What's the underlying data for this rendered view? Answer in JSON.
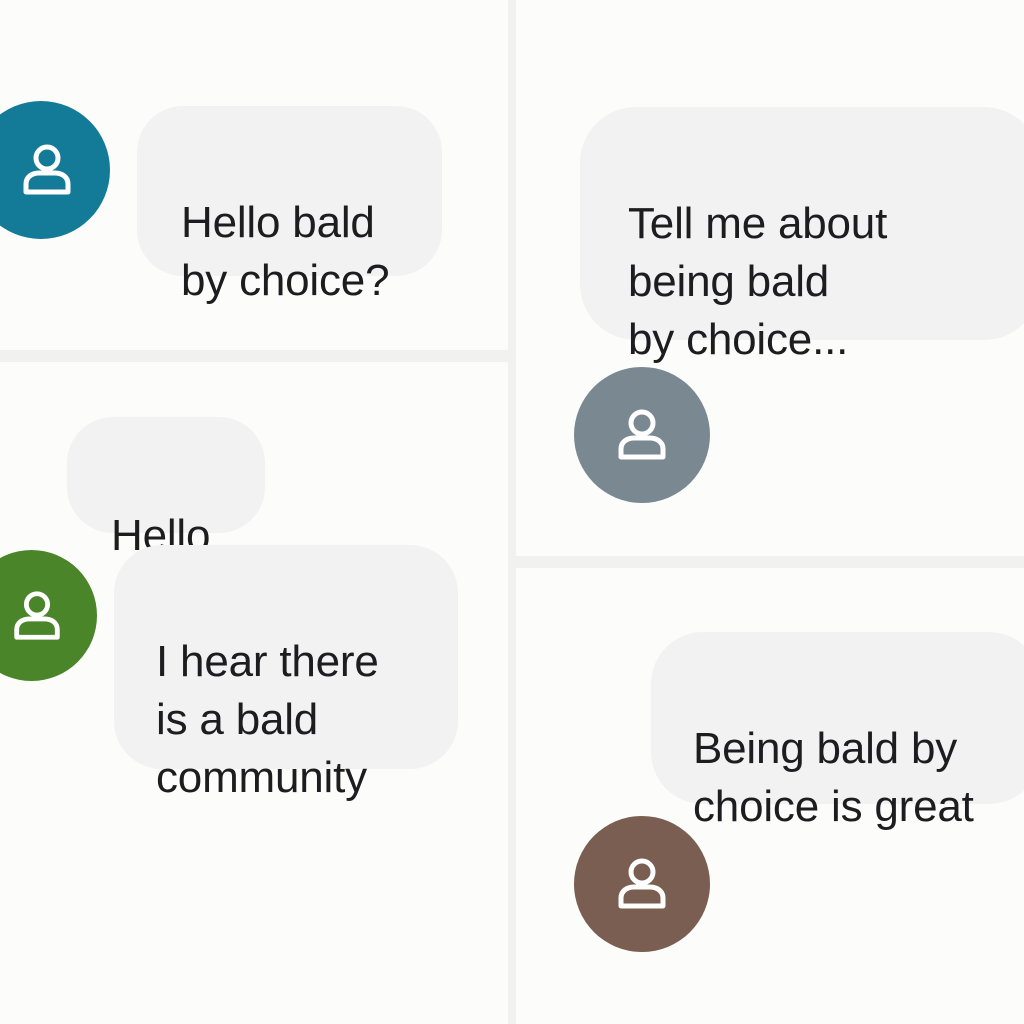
{
  "colors": {
    "background": "#fcfcfb",
    "bubble": "#f2f2f3",
    "text": "#1d1d1f",
    "avatar_teal": "#137a97",
    "avatar_gray": "#798891",
    "avatar_green": "#4b852a",
    "avatar_brown": "#7a5e51",
    "icon": "#ffffff"
  },
  "conversation": {
    "messages": [
      {
        "id": "m1",
        "text": "Hello bald\nby choice?",
        "avatar_color": "avatar_teal",
        "avatar_icon": "person-icon"
      },
      {
        "id": "m2",
        "text": "Tell me about\nbeing bald\nby choice...",
        "avatar_color": "avatar_gray",
        "avatar_icon": "person-icon"
      },
      {
        "id": "m3",
        "text": "Hello"
      },
      {
        "id": "m4",
        "text": "I hear there\nis a bald\ncommunity",
        "avatar_color": "avatar_green",
        "avatar_icon": "person-icon"
      },
      {
        "id": "m5",
        "text": "Being bald by\nchoice is great",
        "avatar_color": "avatar_brown",
        "avatar_icon": "person-icon"
      }
    ]
  }
}
